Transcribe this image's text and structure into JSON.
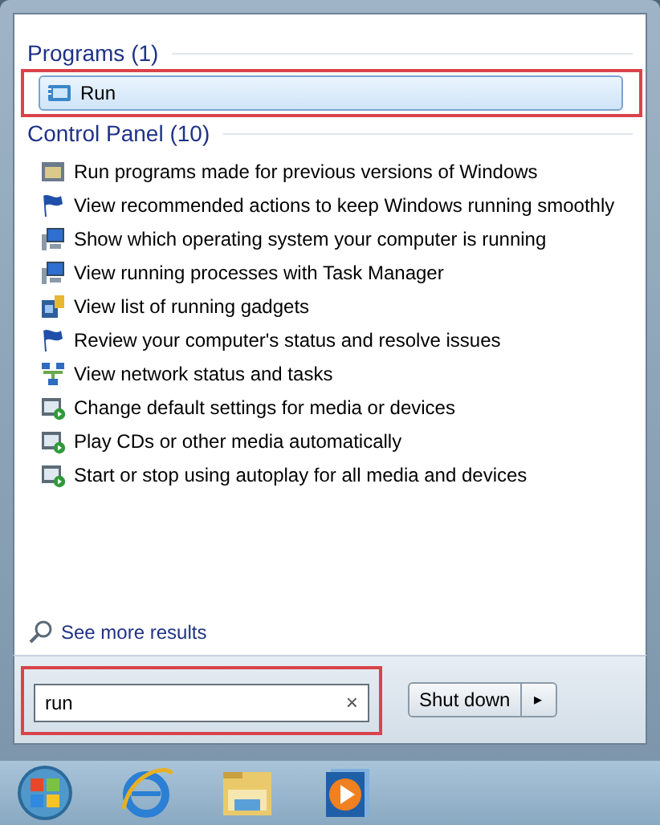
{
  "programs": {
    "heading": "Programs (1)",
    "items": [
      {
        "label": "Run",
        "selected": true,
        "kind": "run"
      }
    ]
  },
  "control_panel": {
    "heading": "Control Panel (10)",
    "items": [
      {
        "label": "Run programs made for previous versions of Windows",
        "kind": "compat"
      },
      {
        "label": "View recommended actions to keep Windows running smoothly",
        "kind": "flag"
      },
      {
        "label": "Show which operating system your computer is running",
        "kind": "monitor"
      },
      {
        "label": "View running processes with Task Manager",
        "kind": "monitor"
      },
      {
        "label": "View list of running gadgets",
        "kind": "gadgets"
      },
      {
        "label": "Review your computer's status and resolve issues",
        "kind": "flag"
      },
      {
        "label": "View network status and tasks",
        "kind": "network"
      },
      {
        "label": "Change default settings for media or devices",
        "kind": "media"
      },
      {
        "label": "Play CDs or other media automatically",
        "kind": "media"
      },
      {
        "label": "Start or stop using autoplay for all media and devices",
        "kind": "media"
      }
    ]
  },
  "see_more": "See more results",
  "search": {
    "value": "run",
    "clear": "×"
  },
  "shutdown": {
    "label": "Shut down",
    "arrow": "▸"
  },
  "taskbar": [
    {
      "kind": "start"
    },
    {
      "kind": "browser"
    },
    {
      "kind": "folder"
    },
    {
      "kind": "player"
    }
  ]
}
